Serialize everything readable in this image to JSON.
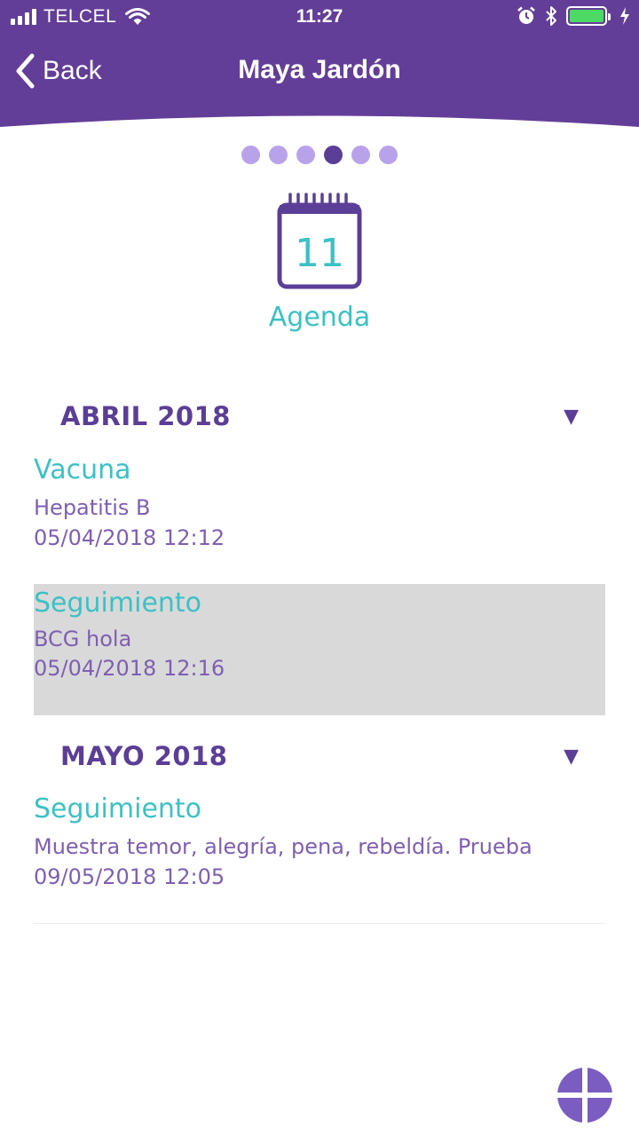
{
  "colors": {
    "header_bg": "#633e98",
    "primary_purple": "#5b3e96",
    "accent_teal": "#3cc1c5",
    "dot_inactive": "#b8a3ea",
    "selected_row_bg": "#d9d9d9",
    "fab_bg": "#7b5cc0",
    "battery_fill": "#4cd964"
  },
  "status_bar": {
    "carrier": "TELCEL",
    "time": "11:27",
    "icons": [
      "signal-bars-icon",
      "wifi-icon",
      "alarm-icon",
      "bluetooth-icon",
      "battery-icon",
      "charging-icon"
    ]
  },
  "nav": {
    "back_label": "Back",
    "title": "Maya Jardón"
  },
  "pager": {
    "count": 6,
    "active_index": 3
  },
  "section_icon": {
    "icon": "calendar-icon",
    "day": "11",
    "label": "Agenda"
  },
  "sections": [
    {
      "title": "ABRIL 2018",
      "caret": "▼",
      "entries": [
        {
          "type": "Vacuna",
          "description": "Hepatitis B",
          "datetime": "05/04/2018 12:12",
          "selected": false
        },
        {
          "type": "Seguimiento",
          "description": "BCG hola",
          "datetime": "05/04/2018 12:16",
          "selected": true
        }
      ]
    },
    {
      "title": "MAYO 2018",
      "caret": "▼",
      "entries": [
        {
          "type": "Seguimiento",
          "description": "Muestra temor, alegría, pena, rebeldía. Prueba",
          "datetime": "09/05/2018 12:05",
          "selected": false
        }
      ]
    }
  ],
  "fab": {
    "icon": "plus-icon"
  }
}
